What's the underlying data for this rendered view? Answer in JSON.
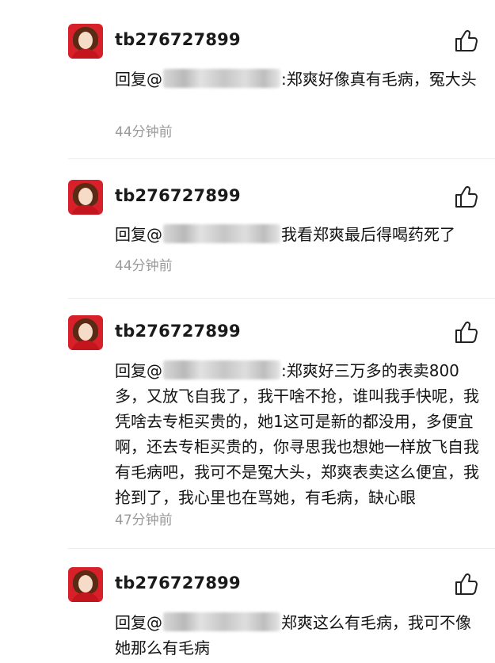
{
  "comments": [
    {
      "username": "tb276727899",
      "reply_prefix": "回复@",
      "text": ":郑爽好像真有毛病，冤大头",
      "time": "44分钟前"
    },
    {
      "username": "tb276727899",
      "reply_prefix": "回复@",
      "text": "我看郑爽最后得喝药死了",
      "time": "44分钟前"
    },
    {
      "username": "tb276727899",
      "reply_prefix": "回复@",
      "text": ":郑爽好三万多的表卖800多，又放飞自我了，我干啥不抢，谁叫我手快呢，我凭啥去专柜买贵的，她1这可是新的都没用，多便宜啊，还去专柜买贵的，你寻思我也想她一样放飞自我有毛病吧，我可不是冤大头，郑爽表卖这么便宜，我抢到了，我心里也在骂她，有毛病，缺心眼",
      "time": "47分钟前"
    },
    {
      "username": "tb276727899",
      "reply_prefix": "回复@",
      "text": "郑爽这么有毛病，我可不像她那么有毛病",
      "time": ""
    }
  ],
  "icons": {
    "like": "thumbs-up-icon",
    "avatar": "avatar-image"
  },
  "colors": {
    "avatar_bg": "#d8202a",
    "time": "#9a9a9a",
    "text": "#141414"
  }
}
